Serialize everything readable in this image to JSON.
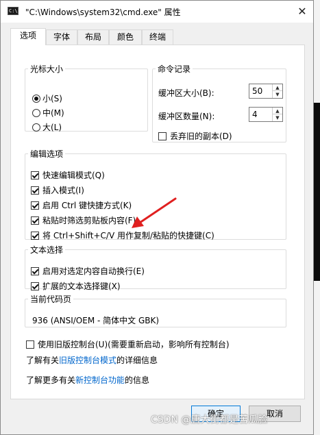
{
  "window": {
    "title": "\"C:\\Windows\\system32\\cmd.exe\" 属性",
    "app_icon_text": "C:\\",
    "close": "✕"
  },
  "tabs": [
    "选项",
    "字体",
    "布局",
    "颜色",
    "终端"
  ],
  "cursor_size": {
    "legend": "光标大小",
    "options": [
      "小(S)",
      "中(M)",
      "大(L)"
    ],
    "selected": "小(S)"
  },
  "history": {
    "legend": "命令记录",
    "buffer_size_label": "缓冲区大小(B):",
    "buffer_size_value": "50",
    "buffer_count_label": "缓冲区数量(N):",
    "buffer_count_value": "4",
    "discard_old_label": "丢弃旧的副本(D)",
    "discard_old_checked": false
  },
  "edit_options": {
    "legend": "编辑选项",
    "items": [
      {
        "label": "快速编辑模式(Q)",
        "checked": true
      },
      {
        "label": "插入模式(I)",
        "checked": true
      },
      {
        "label": "启用 Ctrl 键快捷方式(K)",
        "checked": true
      },
      {
        "label": "粘贴时筛选剪贴板内容(F)",
        "checked": true
      },
      {
        "label": "将 Ctrl+Shift+C/V 用作复制/粘贴的快捷键(C)",
        "checked": true
      }
    ]
  },
  "text_selection": {
    "legend": "文本选择",
    "items": [
      {
        "label": "启用对选定内容自动换行(E)",
        "checked": true
      },
      {
        "label": "扩展的文本选择键(X)",
        "checked": true
      }
    ]
  },
  "codepage": {
    "legend": "当前代码页",
    "value": "936   (ANSI/OEM - 简体中文 GBK)"
  },
  "legacy": {
    "label": "使用旧版控制台(U)(需要重新启动，影响所有控制台)",
    "checked": false,
    "learn_prefix": "了解有关",
    "learn_link": "旧版控制台模式",
    "learn_suffix": "的详细信息",
    "more_prefix": "了解更多有关",
    "more_link": "新控制台功能",
    "more_suffix": "的信息"
  },
  "buttons": {
    "ok": "确定",
    "cancel": "取消"
  },
  "watermark": "CSDN @唐大街都是苦瓜脸",
  "colors": {
    "link": "#0066cc",
    "annotation_arrow": "#e02020",
    "default_button_border": "#0078d7"
  }
}
